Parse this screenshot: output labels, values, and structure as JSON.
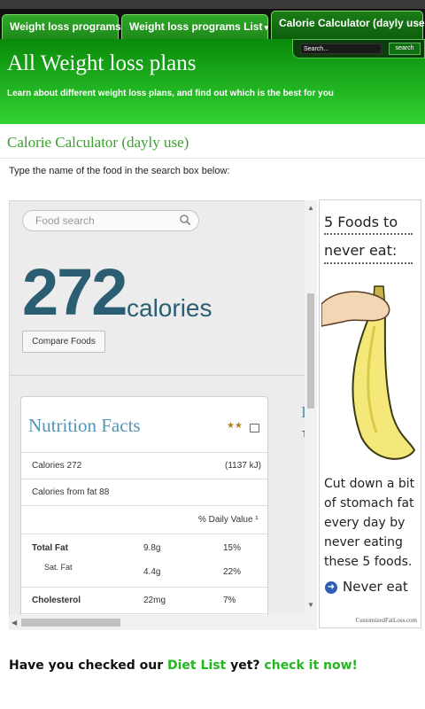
{
  "nav": {
    "tabs": [
      {
        "label": "Weight loss programs"
      },
      {
        "label": "Weight loss programs List"
      },
      {
        "label": "Calorie Calculator (dayly use)"
      }
    ],
    "dropdown_glyph": "▾",
    "search_placeholder": "Search...",
    "search_button": "search"
  },
  "header": {
    "title": "All Weight loss plans",
    "subtitle": "Learn about different weight loss plans, and find out which is the best for you"
  },
  "page": {
    "title": "Calorie Calculator (dayly use)",
    "instructions": "Type the name of the food in the search box below:"
  },
  "widget": {
    "search_placeholder": "Food search",
    "calories_value": "272",
    "calories_label": "calories",
    "compare_button": "Compare Foods",
    "nutrition": {
      "title": "Nutrition Facts",
      "rows": [
        {
          "label": "Calories 272",
          "amount": "",
          "value": "(1137 kJ)"
        },
        {
          "label": "Calories from fat 88",
          "amount": "",
          "value": ""
        },
        {
          "label": "",
          "amount": "",
          "value": "% Daily Value ¹"
        },
        {
          "label": "Total Fat",
          "amount": "9.8g",
          "value": "15%"
        },
        {
          "label": "Sat. Fat",
          "amount": "4.4g",
          "value": "22%"
        },
        {
          "label": "Cholesterol",
          "amount": "22mg",
          "value": "7%"
        }
      ]
    },
    "side_peek_letter": "I",
    "side_peek_letter2": "T"
  },
  "ad": {
    "heading_line1": "5 Foods to",
    "heading_line2": "never eat:",
    "body_lines": [
      "Cut down a bit",
      "of stomach fat",
      "every day by",
      "never eating",
      "these 5 foods."
    ],
    "cta": "Never eat",
    "footer": "CustomizedFatLoss.com"
  },
  "bottom": {
    "text_a": "Have you checked our ",
    "link_a": "Diet List",
    "text_b": " yet? ",
    "link_b": "check it now!"
  },
  "colors": {
    "header_green": "#31d232",
    "title_green": "#3aa12d",
    "calorie_blue": "#2b5d73",
    "nutrition_title_blue": "#4f97b5",
    "link_green": "#22b81f"
  }
}
